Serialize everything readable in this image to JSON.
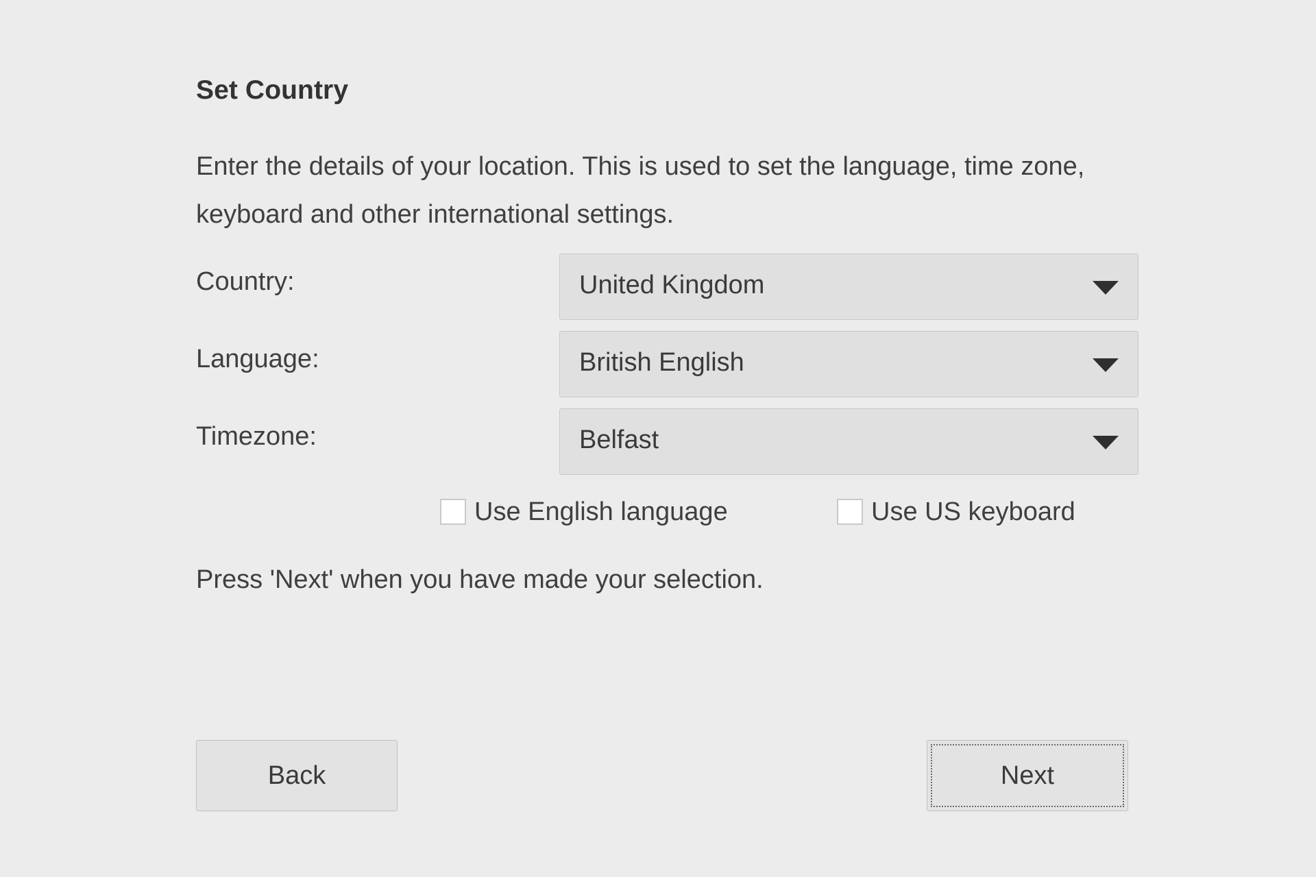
{
  "page": {
    "title": "Set Country",
    "description": "Enter the details of your location. This is used to set the language, time zone, keyboard and other international settings.",
    "hint": "Press 'Next' when you have made your selection.",
    "background_color": "#ececec",
    "text_color": "#3f3f3f"
  },
  "form": {
    "rows": [
      {
        "label": "Country:",
        "value": "United Kingdom",
        "arrow_icon": "chevron-down-icon"
      },
      {
        "label": "Language:",
        "value": "British English",
        "arrow_icon": "chevron-down-icon"
      },
      {
        "label": "Timezone:",
        "value": "Belfast",
        "arrow_icon": "chevron-down-icon"
      }
    ],
    "checkboxes": [
      {
        "label": "Use English language",
        "checked": false
      },
      {
        "label": "Use US keyboard",
        "checked": false
      }
    ]
  },
  "footer": {
    "back_label": "Back",
    "next_label": "Next",
    "next_focused": true
  }
}
